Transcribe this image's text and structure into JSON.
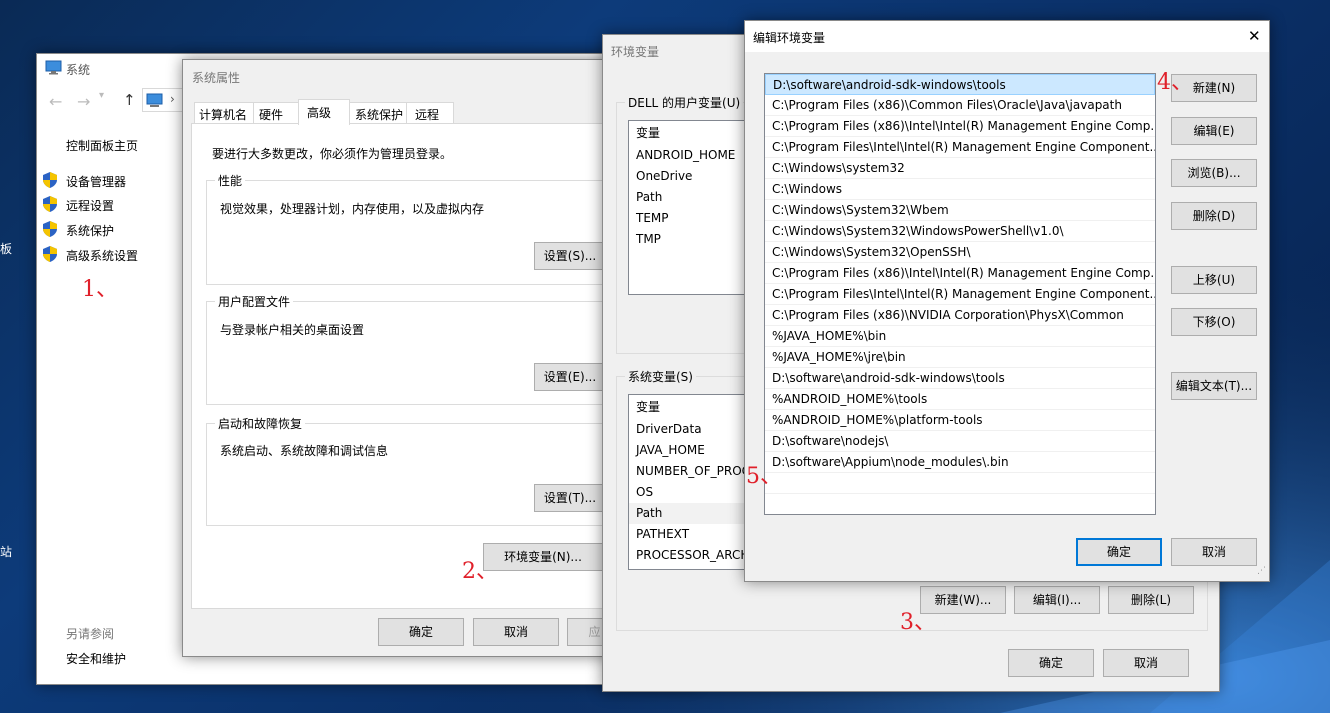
{
  "desktop": {
    "edge_glyphs": [
      "板",
      "站"
    ]
  },
  "system_window": {
    "title": "系统",
    "nav": {
      "back": "←",
      "forward": "→",
      "up": "↑",
      "chevron": "›"
    },
    "sidebar_home": "控制面板主页",
    "links": [
      "设备管理器",
      "远程设置",
      "系统保护",
      "高级系统设置"
    ],
    "see_also": "另请参阅",
    "security_link": "安全和维护"
  },
  "sys_props": {
    "title": "系统属性",
    "tabs": [
      "计算机名",
      "硬件",
      "高级",
      "系统保护",
      "远程"
    ],
    "admin_note": "要进行大多数更改，你必须作为管理员登录。",
    "performance": {
      "title": "性能",
      "desc": "视觉效果，处理器计划，内存使用，以及虚拟内存",
      "button": "设置(S)..."
    },
    "user_profiles": {
      "title": "用户配置文件",
      "desc": "与登录帐户相关的桌面设置",
      "button": "设置(E)..."
    },
    "startup": {
      "title": "启动和故障恢复",
      "desc": "系统启动、系统故障和调试信息",
      "button": "设置(T)..."
    },
    "env_button": "环境变量(N)...",
    "ok": "确定",
    "cancel": "取消",
    "apply": "应"
  },
  "env_window": {
    "title": "环境变量",
    "user_group": "DELL 的用户变量(U)",
    "var_header": "变量",
    "user_vars": [
      "ANDROID_HOME",
      "OneDrive",
      "Path",
      "TEMP",
      "TMP"
    ],
    "system_group": "系统变量(S)",
    "system_vars": [
      "DriverData",
      "JAVA_HOME",
      "NUMBER_OF_PROC",
      "OS",
      "Path",
      "PATHEXT",
      "PROCESSOR_ARCH"
    ],
    "new": "新建(W)...",
    "edit": "编辑(I)...",
    "delete": "删除(L)",
    "ok": "确定",
    "cancel": "取消"
  },
  "edit_env": {
    "title": "编辑环境变量",
    "close": "✕",
    "paths": [
      "D:\\software\\android-sdk-windows\\tools",
      "C:\\Program Files (x86)\\Common Files\\Oracle\\Java\\javapath",
      "C:\\Program Files (x86)\\Intel\\Intel(R) Management Engine Comp...",
      "C:\\Program Files\\Intel\\Intel(R) Management Engine Component...",
      "C:\\Windows\\system32",
      "C:\\Windows",
      "C:\\Windows\\System32\\Wbem",
      "C:\\Windows\\System32\\WindowsPowerShell\\v1.0\\",
      "C:\\Windows\\System32\\OpenSSH\\",
      "C:\\Program Files (x86)\\Intel\\Intel(R) Management Engine Comp...",
      "C:\\Program Files\\Intel\\Intel(R) Management Engine Component...",
      "C:\\Program Files (x86)\\NVIDIA Corporation\\PhysX\\Common",
      "%JAVA_HOME%\\bin",
      "%JAVA_HOME%\\jre\\bin",
      "D:\\software\\android-sdk-windows\\tools",
      "%ANDROID_HOME%\\tools",
      "%ANDROID_HOME%\\platform-tools",
      "D:\\software\\nodejs\\",
      "D:\\software\\Appium\\node_modules\\.bin"
    ],
    "selected_index": 0,
    "buttons": {
      "new": "新建(N)",
      "edit": "编辑(E)",
      "browse": "浏览(B)...",
      "delete": "删除(D)",
      "up": "上移(U)",
      "down": "下移(O)",
      "edit_text": "编辑文本(T)..."
    },
    "ok": "确定",
    "cancel": "取消"
  },
  "annotations": [
    "1、",
    "2、",
    "3、",
    "4、",
    "5、"
  ],
  "colors": {
    "selection": "#cce8ff",
    "selection_border": "#99d1ff",
    "annotation": "#e0202a",
    "default_button_border": "#0078d7"
  }
}
